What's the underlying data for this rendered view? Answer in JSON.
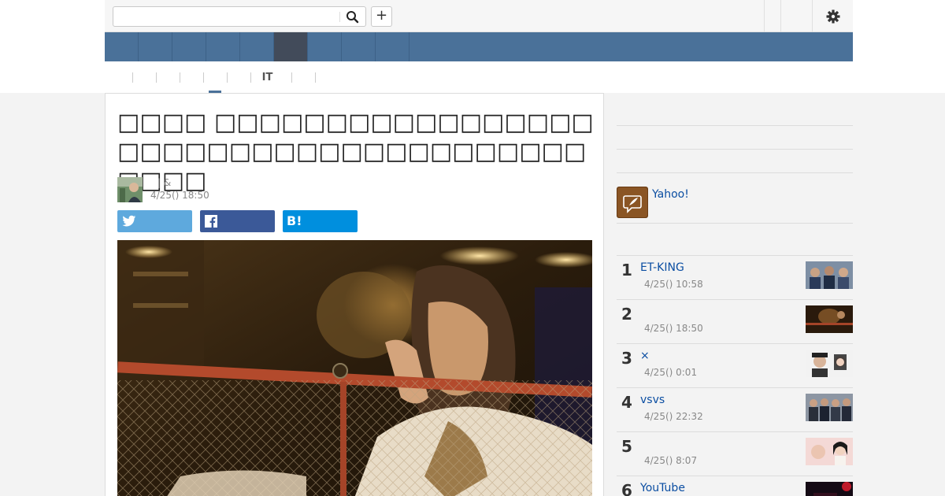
{
  "header": {
    "search_placeholder": "",
    "search_value": "",
    "plus_label": "+"
  },
  "nav": {
    "items": [
      "",
      "",
      "",
      "",
      "",
      "",
      "",
      "",
      ""
    ],
    "active_index": 4
  },
  "subnav": {
    "items": [
      "",
      "",
      "",
      "",
      "",
      "IT",
      "",
      ""
    ],
    "active_index": 4
  },
  "article": {
    "title": "□□□□ □□□□□□□□□□□□□□□□□□□□□□□□□□□□□□□□□□□□□□□□□□",
    "author_meta": "| &",
    "date": "4/25() 18:50"
  },
  "share": {
    "twitter_icon": "twitter-bird-icon",
    "facebook_icon": "facebook-f-icon",
    "hatena_label": "B!"
  },
  "sidebar": {
    "yahoo_link": "Yahoo!",
    "ranking": [
      {
        "rank": "1",
        "title": "ET-KING",
        "time": "4/25() 10:58"
      },
      {
        "rank": "2",
        "title": "",
        "time": "4/25() 18:50"
      },
      {
        "rank": "3",
        "title": "×",
        "time": "4/25() 0:01"
      },
      {
        "rank": "4",
        "title": "vsvs",
        "time": "4/25() 22:32"
      },
      {
        "rank": "5",
        "title": "",
        "time": "4/25() 8:07"
      },
      {
        "rank": "6",
        "title": "YouTube",
        "time": ""
      }
    ]
  },
  "colors": {
    "nav_bg": "#4a7199",
    "nav_active": "#424b5a",
    "link": "#0b4ea2",
    "twitter": "#5ea9dd",
    "facebook": "#3b5998",
    "hatena": "#008fde"
  }
}
